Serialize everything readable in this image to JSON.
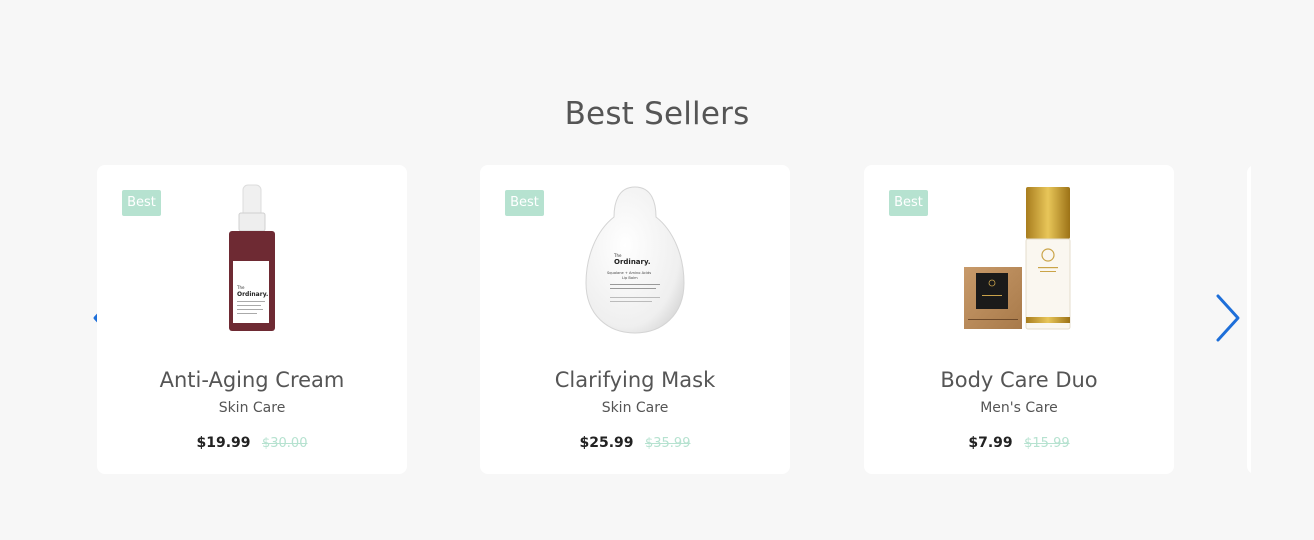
{
  "section": {
    "title": "Best Sellers"
  },
  "products": [
    {
      "badge": "Best",
      "name": "Anti-Aging Cream",
      "category": "Skin Care",
      "price": "$19.99",
      "old_price": "$30.00"
    },
    {
      "badge": "Best",
      "name": "Clarifying Mask",
      "category": "Skin Care",
      "price": "$25.99",
      "old_price": "$35.99"
    },
    {
      "badge": "Best",
      "name": "Body Care Duo",
      "category": "Men's Care",
      "price": "$7.99",
      "old_price": "$15.99"
    }
  ],
  "labels": {
    "serum_brand_top": "The",
    "serum_brand": "Ordinary.",
    "mask_brand_top": "The",
    "mask_brand": "Ordinary.",
    "mask_line1": "Squalane + Amino Acids",
    "mask_line2": "Lip Balm"
  },
  "navigation": {
    "prev_icon": "chevron-left-icon",
    "next_icon": "chevron-right-icon"
  },
  "colors": {
    "background": "#f7f7f7",
    "card": "#ffffff",
    "badge": "#b6e2d0",
    "old_price": "#b6e2d0",
    "arrow": "#1e6fd9",
    "heading": "#555555"
  }
}
